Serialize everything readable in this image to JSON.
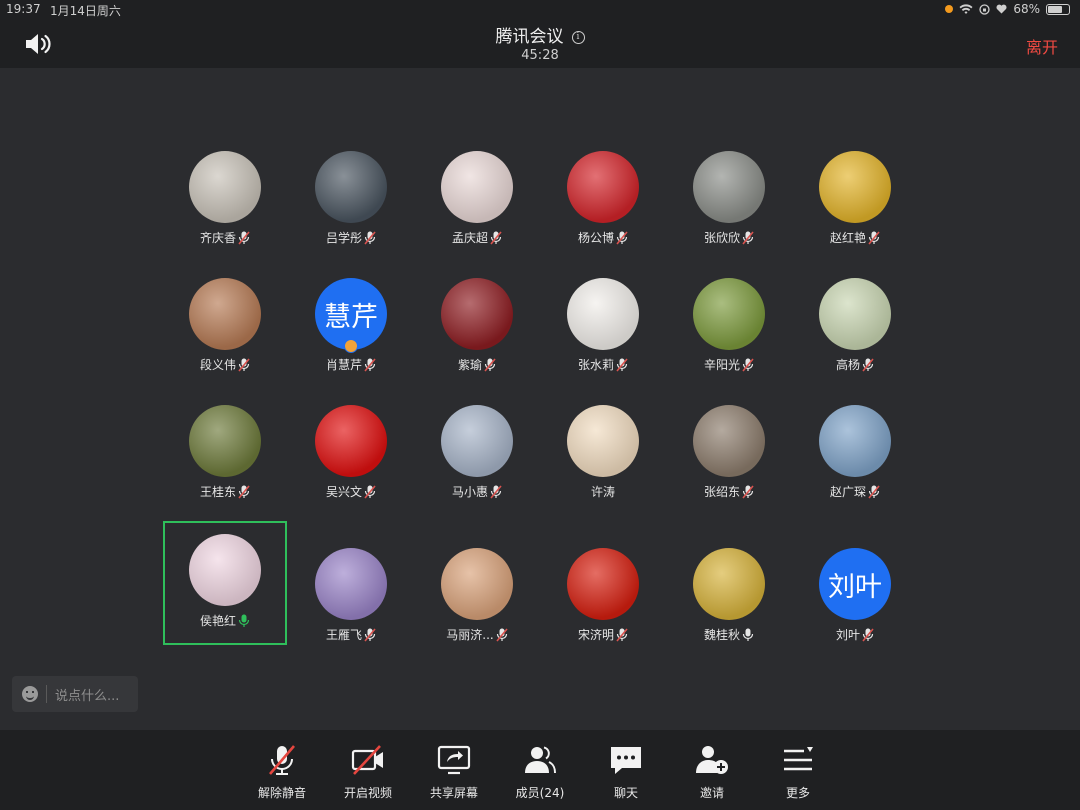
{
  "status_bar": {
    "time": "19:37",
    "date": "1月14日周六",
    "battery": "68%"
  },
  "header": {
    "title": "腾讯会议",
    "timer": "45:28",
    "leave_label": "离开"
  },
  "participants": [
    {
      "name": "齐庆香",
      "mic": "muted",
      "avatar": {
        "type": "image",
        "bg": "#c8c2b8"
      }
    },
    {
      "name": "吕学彤",
      "mic": "muted",
      "avatar": {
        "type": "image",
        "bg": "#4a5560"
      }
    },
    {
      "name": "孟庆超",
      "mic": "muted",
      "avatar": {
        "type": "image",
        "bg": "#e9d8d6"
      }
    },
    {
      "name": "杨公博",
      "mic": "muted",
      "avatar": {
        "type": "image",
        "bg": "#d3242a"
      }
    },
    {
      "name": "张欣欣",
      "mic": "muted",
      "avatar": {
        "type": "image",
        "bg": "#8a8d88"
      }
    },
    {
      "name": "赵红艳",
      "mic": "muted",
      "avatar": {
        "type": "image",
        "bg": "#e3b42a"
      }
    },
    {
      "name": "段义伟",
      "mic": "muted",
      "avatar": {
        "type": "image",
        "bg": "#b67a54"
      }
    },
    {
      "name": "肖慧芹",
      "mic": "muted",
      "avatar": {
        "type": "text",
        "text": "慧芹",
        "bg": "#1f6ff2"
      },
      "host": true
    },
    {
      "name": "紫瑜",
      "mic": "muted",
      "avatar": {
        "type": "image",
        "bg": "#8e1d22"
      }
    },
    {
      "name": "张水莉",
      "mic": "muted",
      "avatar": {
        "type": "image",
        "bg": "#f1eeea"
      }
    },
    {
      "name": "辛阳光",
      "mic": "muted",
      "avatar": {
        "type": "image",
        "bg": "#7c9a3c"
      }
    },
    {
      "name": "高杨",
      "mic": "muted",
      "avatar": {
        "type": "image",
        "bg": "#c9d6b2"
      }
    },
    {
      "name": "王桂东",
      "mic": "muted",
      "avatar": {
        "type": "image",
        "bg": "#6d7a3a"
      }
    },
    {
      "name": "吴兴文",
      "mic": "muted",
      "avatar": {
        "type": "image",
        "bg": "#e01010"
      }
    },
    {
      "name": "马小惠",
      "mic": "muted",
      "avatar": {
        "type": "image",
        "bg": "#a7b4c8"
      }
    },
    {
      "name": "许涛",
      "mic": "none",
      "avatar": {
        "type": "image",
        "bg": "#f1dcc0"
      }
    },
    {
      "name": "张绍东",
      "mic": "muted",
      "avatar": {
        "type": "image",
        "bg": "#8c7c6c"
      }
    },
    {
      "name": "赵广琛",
      "mic": "muted",
      "avatar": {
        "type": "image",
        "bg": "#7fa3c8"
      }
    },
    {
      "name": "侯艳红",
      "mic": "speaking",
      "avatar": {
        "type": "image",
        "bg": "#f0d6e2"
      },
      "active": true
    },
    {
      "name": "王雁飞",
      "mic": "muted",
      "avatar": {
        "type": "image",
        "bg": "#9a84c8"
      }
    },
    {
      "name": "马丽济...",
      "mic": "muted",
      "avatar": {
        "type": "image",
        "bg": "#d9a27a"
      }
    },
    {
      "name": "宋济明",
      "mic": "muted",
      "avatar": {
        "type": "image",
        "bg": "#d61f10"
      }
    },
    {
      "name": "魏桂秋",
      "mic": "on",
      "avatar": {
        "type": "image",
        "bg": "#d6b23a"
      }
    },
    {
      "name": "刘叶",
      "mic": "muted",
      "avatar": {
        "type": "text",
        "text": "刘叶",
        "bg": "#1f6ff2"
      }
    }
  ],
  "chat": {
    "placeholder": "说点什么..."
  },
  "toolbar": [
    {
      "id": "unmute",
      "label": "解除静音",
      "icon": "mic-off-icon"
    },
    {
      "id": "video",
      "label": "开启视频",
      "icon": "camera-off-icon"
    },
    {
      "id": "share",
      "label": "共享屏幕",
      "icon": "share-screen-icon"
    },
    {
      "id": "members",
      "label": "成员(24)",
      "icon": "members-icon"
    },
    {
      "id": "chat",
      "label": "聊天",
      "icon": "chat-icon"
    },
    {
      "id": "invite",
      "label": "邀请",
      "icon": "add-user-icon"
    },
    {
      "id": "more",
      "label": "更多",
      "icon": "more-icon"
    }
  ],
  "colors": {
    "background": "#2b2c2f",
    "bar": "#1f2022",
    "leave": "#f04a42",
    "active_border": "#2fbf5b",
    "muted_mic": "#d9534f"
  }
}
